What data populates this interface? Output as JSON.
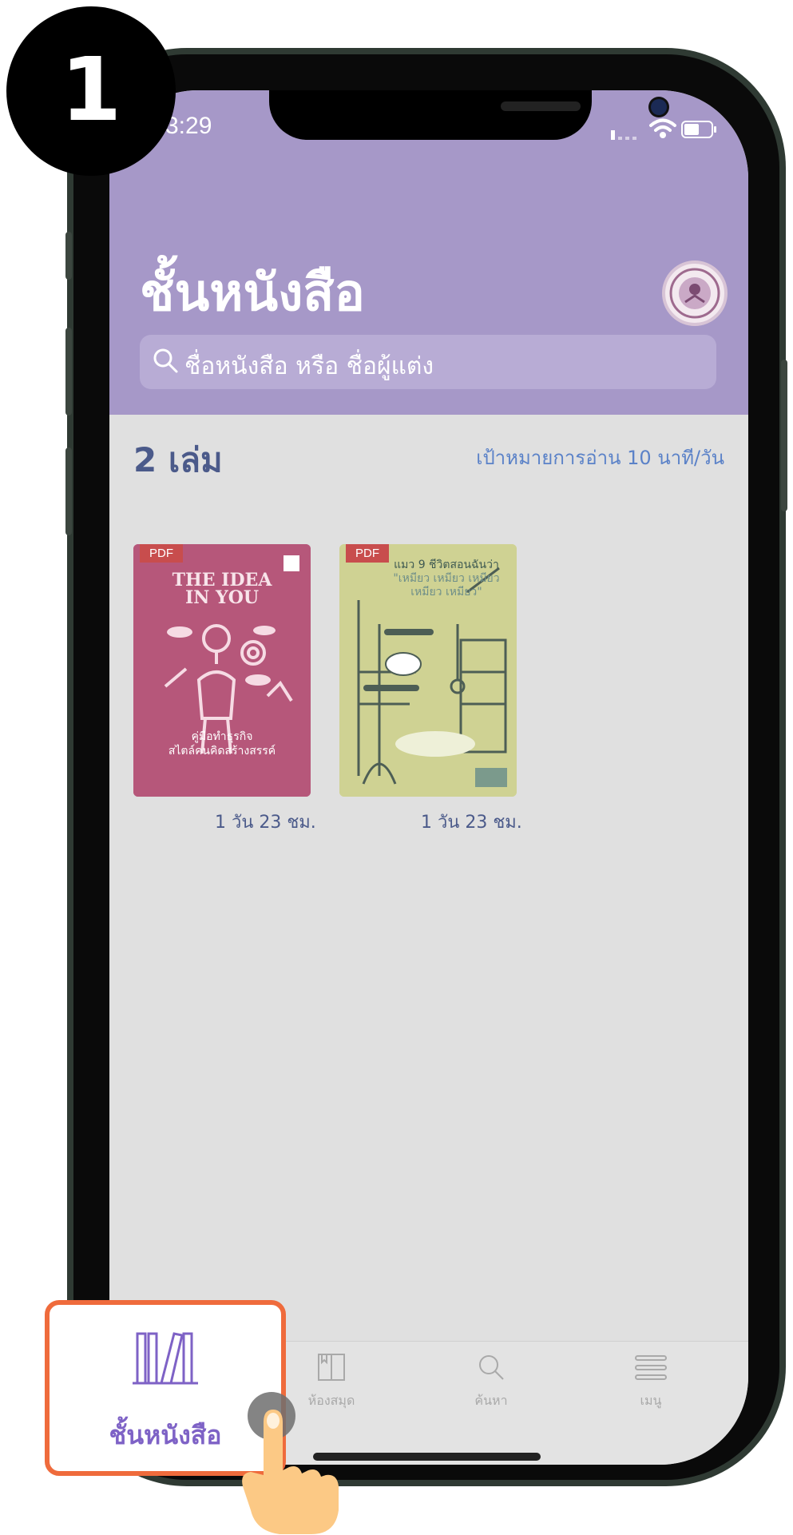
{
  "step": {
    "number": "1"
  },
  "status_bar": {
    "time": "3:29"
  },
  "header": {
    "title": "ชั้นหนังสือ",
    "search_placeholder": "ชื่อหนังสือ หรือ ชื่อผู้แต่ง"
  },
  "shelf": {
    "count_label": "2 เล่ม",
    "goal_label": "เป้าหมายการอ่าน 10 นาที/วัน",
    "books": [
      {
        "badge": "PDF",
        "cover_title_line1": "THE IDEA",
        "cover_title_line2": "IN YOU",
        "cover_subtitle_line1": "คู่มือทำธุรกิจ",
        "cover_subtitle_line2": "สไตล์คนคิดสร้างสรรค์",
        "time_left": "1 วัน 23 ชม."
      },
      {
        "badge": "PDF",
        "cover_title_line1": "แมว 9 ชีวิตสอนฉันว่า",
        "cover_title_line2": "\"เหมียว เหมียว เหมียว",
        "cover_title_line3": "เหมียว เหมียว\"",
        "time_left": "1 วัน 23 ชม."
      }
    ]
  },
  "tabbar": {
    "tabs": [
      {
        "label": "ชั้นหนังสือ",
        "icon": "bookshelf-icon",
        "active": true
      },
      {
        "label": "ห้องสมุด",
        "icon": "library-icon"
      },
      {
        "label": "ค้นหา",
        "icon": "search-icon"
      },
      {
        "label": "เมนู",
        "icon": "menu-icon"
      }
    ]
  },
  "colors": {
    "header": "#a698c8",
    "accent": "#7e62c6",
    "highlight_border": "#ef6b3c",
    "count_text": "#4b5a8a",
    "goal_text": "#5b82c8"
  }
}
